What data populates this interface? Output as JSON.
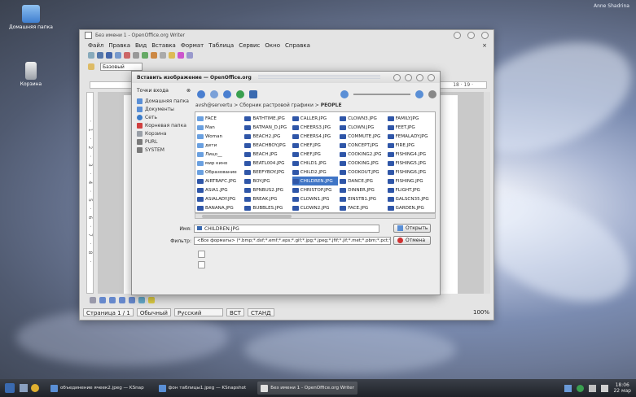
{
  "desktop": {
    "icons": [
      {
        "label": "Домашняя папка",
        "icon": "folder-home-icon"
      },
      {
        "label": "Корзина",
        "icon": "trash-icon"
      }
    ],
    "user": "Anne Shadrina"
  },
  "writer": {
    "title": "Без имени 1 - OpenOffice.org Writer",
    "menu": [
      "Файл",
      "Правка",
      "Вид",
      "Вставка",
      "Формат",
      "Таблица",
      "Сервис",
      "Окно",
      "Справка"
    ],
    "style_value": "Базовый",
    "ruler_left_marks": "· 1 · 2 · 3 · 4 · 5 · 6 · 7 · 8 ·",
    "ruler_right_marks": "18 · 19 ·",
    "status": {
      "page": "Страница 1 / 1",
      "style": "Обычный",
      "language": "Русский",
      "insert_mode": "ВСТ",
      "select_mode": "СТАНД",
      "zoom": "100%"
    }
  },
  "dialog": {
    "title": "Вставить изображение — OpenOffice.org",
    "places_header": "Точки входа",
    "places": [
      {
        "label": "Домашняя папка",
        "color": "#5a8fd6"
      },
      {
        "label": "Документы",
        "color": "#5a8fd6"
      },
      {
        "label": "Сеть",
        "color": "#3a7bc8"
      },
      {
        "label": "Корневая папка",
        "color": "#d04040"
      },
      {
        "label": "Корзина",
        "color": "#9aa0a8"
      },
      {
        "label": "PURL",
        "color": "#7a7a7a"
      },
      {
        "label": "SYSTEM",
        "color": "#7a7a7a"
      }
    ],
    "breadcrumb_prefix": "avsh@servertu",
    "breadcrumb_mid": "Сборник растровой графики",
    "breadcrumb_current": "PEOPLE",
    "files": [
      {
        "name": "FACE",
        "type": "folder"
      },
      {
        "name": "Man",
        "type": "folder"
      },
      {
        "name": "Woman",
        "type": "folder"
      },
      {
        "name": "дети",
        "type": "folder"
      },
      {
        "name": "Лицо__",
        "type": "folder"
      },
      {
        "name": "мир кино",
        "type": "folder"
      },
      {
        "name": "Образование",
        "type": "folder"
      },
      {
        "name": "AIRTRAFC.JPG",
        "type": "image"
      },
      {
        "name": "ASIA1.JPG",
        "type": "image"
      },
      {
        "name": "ASIALADY.JPG",
        "type": "image"
      },
      {
        "name": "BANANA.JPG",
        "type": "image"
      },
      {
        "name": "BATHTIME.JPG",
        "type": "image"
      },
      {
        "name": "BATMAN_D.JPG",
        "type": "image"
      },
      {
        "name": "BEACH2.JPG",
        "type": "image"
      },
      {
        "name": "BEACHBOY.JPG",
        "type": "image"
      },
      {
        "name": "BEACH.JPG",
        "type": "image"
      },
      {
        "name": "BEATL004.JPG",
        "type": "image"
      },
      {
        "name": "BEEFYBOY.JPG",
        "type": "image"
      },
      {
        "name": "BOY.JPG",
        "type": "image"
      },
      {
        "name": "BPNBUS2.JPG",
        "type": "image"
      },
      {
        "name": "BREAK.JPG",
        "type": "image"
      },
      {
        "name": "BUBBLES.JPG",
        "type": "image"
      },
      {
        "name": "CALLER.JPG",
        "type": "image"
      },
      {
        "name": "CHEERS3.JPG",
        "type": "image"
      },
      {
        "name": "CHEERS4.JPG",
        "type": "image"
      },
      {
        "name": "CHEF.JPG",
        "type": "image"
      },
      {
        "name": "CHEF.JPG",
        "type": "image"
      },
      {
        "name": "CHILD1.JPG",
        "type": "image"
      },
      {
        "name": "CHILD2.JPG",
        "type": "image"
      },
      {
        "name": "CHILDREN.JPG",
        "type": "image",
        "selected": true
      },
      {
        "name": "CHRISTOP.JPG",
        "type": "image"
      },
      {
        "name": "CLOWN1.JPG",
        "type": "image"
      },
      {
        "name": "CLOWN2.JPG",
        "type": "image"
      },
      {
        "name": "CLOWN3.JPG",
        "type": "image"
      },
      {
        "name": "CLOWN.JPG",
        "type": "image"
      },
      {
        "name": "COMMUTE.JPG",
        "type": "image"
      },
      {
        "name": "CONCEPT.JPG",
        "type": "image"
      },
      {
        "name": "COOKING2.JPG",
        "type": "image"
      },
      {
        "name": "COOKING.JPG",
        "type": "image"
      },
      {
        "name": "COOKOUT.JPG",
        "type": "image"
      },
      {
        "name": "DANCE.JPG",
        "type": "image"
      },
      {
        "name": "DINNER.JPG",
        "type": "image"
      },
      {
        "name": "EINSTB1.JPG",
        "type": "image"
      },
      {
        "name": "FACE.JPG",
        "type": "image"
      },
      {
        "name": "FAMILY.JPG",
        "type": "image"
      },
      {
        "name": "FEET.JPG",
        "type": "image"
      },
      {
        "name": "FEMALADY.JPG",
        "type": "image"
      },
      {
        "name": "FIRE.JPG",
        "type": "image"
      },
      {
        "name": "FISHING4.JPG",
        "type": "image"
      },
      {
        "name": "FISHING5.JPG",
        "type": "image"
      },
      {
        "name": "FISHING6.JPG",
        "type": "image"
      },
      {
        "name": "FISHING.JPG",
        "type": "image"
      },
      {
        "name": "FLIGHT.JPG",
        "type": "image"
      },
      {
        "name": "GALSCN35.JPG",
        "type": "image"
      },
      {
        "name": "GARDEN.JPG",
        "type": "image"
      }
    ],
    "name_label": "Имя:",
    "name_value": "CHILDREN.JPG",
    "filter_label": "Фильтр:",
    "filter_value": "<Все форматы> (*.bmp;*.dxf;*.emf;*.eps;*.gif;*.jpg;*.jpeg;*.jfif;*.jif;*.met;*.pbm;*.pct;*.pic",
    "open_label": "Открыть",
    "cancel_label": "Отмена"
  },
  "taskbar": {
    "tasks": [
      {
        "label": "объединение ячеек2.jpeg — KSnap",
        "active": false
      },
      {
        "label": "фон таблицы1.jpeg — KSnapshot",
        "active": false
      },
      {
        "label": "Без имени 1 - OpenOffice.org Writer",
        "active": true
      }
    ],
    "time": "18:06",
    "date": "22 мар"
  }
}
